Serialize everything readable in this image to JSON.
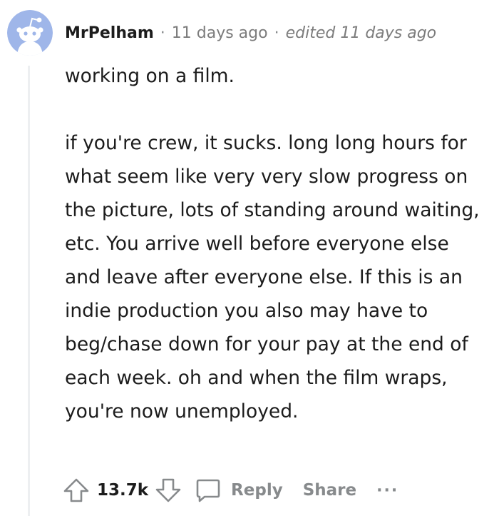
{
  "comment": {
    "author": "MrPelham",
    "separator": "·",
    "age": "11 days ago",
    "edited": "edited 11 days ago",
    "paragraphs": [
      "working on a film.",
      "if you're crew, it sucks. long long hours for what seem like very very slow progress on the picture, lots of standing around waiting, etc. You arrive well before everyone else and leave after everyone else. If this is an indie production you also may have to beg/chase down for your pay at the end of each week. oh and when the film wraps, you're now unemployed."
    ]
  },
  "actions": {
    "score": "13.7k",
    "reply_label": "Reply",
    "share_label": "Share",
    "more_label": "···"
  },
  "icons": {
    "avatar": "snoo-avatar-icon",
    "upvote": "upvote-arrow-icon",
    "downvote": "downvote-arrow-icon",
    "reply": "comment-bubble-icon"
  },
  "colors": {
    "avatar_bg": "#9fb6e9",
    "snoo": "#ffffff",
    "muted_text": "#878a8c",
    "thread_line": "#edeff1"
  }
}
